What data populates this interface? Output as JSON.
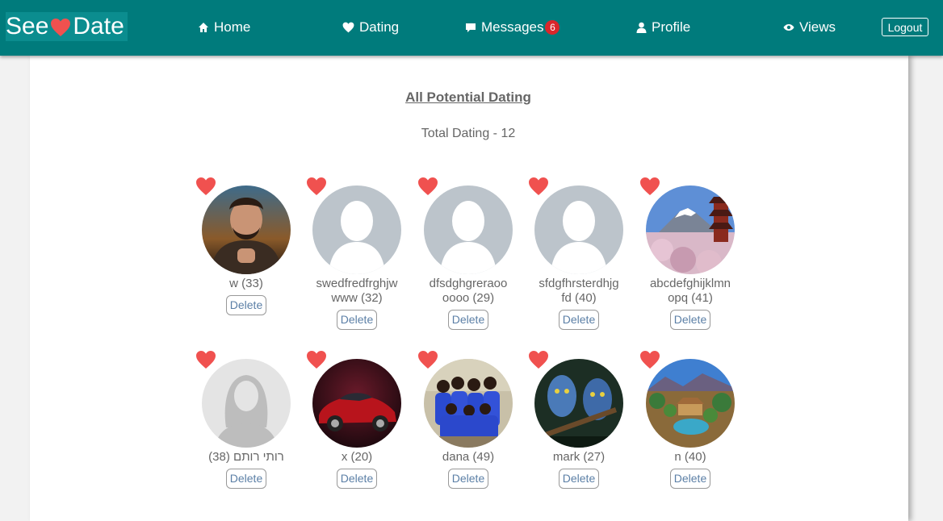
{
  "brand": {
    "name_left": "See",
    "name_right": "Date"
  },
  "nav": {
    "home": "Home",
    "dating": "Dating",
    "messages": "Messages",
    "messages_count": "6",
    "profile": "Profile",
    "views": "Views",
    "logout": "Logout"
  },
  "page": {
    "title": "All Potential Dating",
    "total": "Total Dating - 12"
  },
  "cards": [
    {
      "line1": "w (33)",
      "line2": "",
      "delete": "Delete",
      "photo": "man-portrait"
    },
    {
      "line1": "swedfredfrghjw",
      "line2": "www (32)",
      "delete": "Delete",
      "photo": "placeholder"
    },
    {
      "line1": "dfsdghgreraoo",
      "line2": "oooo (29)",
      "delete": "Delete",
      "photo": "placeholder"
    },
    {
      "line1": "sfdgfhrsterdhjg",
      "line2": "fd (40)",
      "delete": "Delete",
      "photo": "placeholder"
    },
    {
      "line1": "abcdefghijklmn",
      "line2": "opq (41)",
      "delete": "Delete",
      "photo": "mount-fuji-pagoda"
    },
    {
      "line1": "רותי רותם (38)",
      "line2": "",
      "delete": "Delete",
      "photo": "female-placeholder"
    },
    {
      "line1": "x (20)",
      "line2": "",
      "delete": "Delete",
      "photo": "red-car"
    },
    {
      "line1": "dana (49)",
      "line2": "",
      "delete": "Delete",
      "photo": "group-blue-dresses"
    },
    {
      "line1": "mark (27)",
      "line2": "",
      "delete": "Delete",
      "photo": "avatar-movie"
    },
    {
      "line1": "n (40)",
      "line2": "",
      "delete": "Delete",
      "photo": "resort-landscape"
    }
  ],
  "colors": {
    "navbar": "#007b7c",
    "heart": "#f0514f",
    "badge": "#d9262b",
    "link": "#5b7fa6"
  }
}
